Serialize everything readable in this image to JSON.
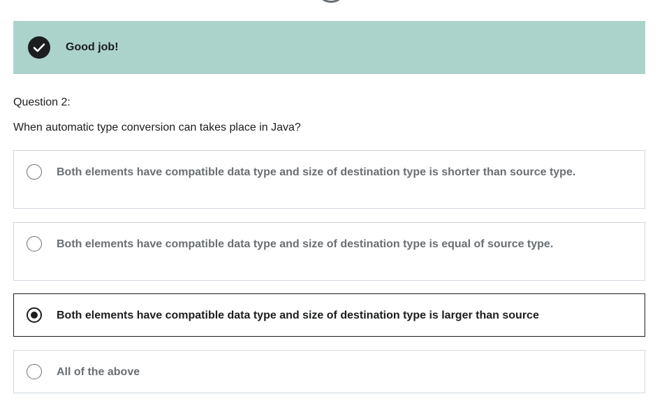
{
  "result": {
    "message": "Good job!",
    "icon": "check-circle-icon",
    "background_color": "#acd2cc"
  },
  "question": {
    "number_label": "Question 2:",
    "text": "When automatic type conversion can takes place in Java?"
  },
  "options": [
    {
      "label": "Both elements have compatible data type and size of destination type is shorter than source type.",
      "selected": false
    },
    {
      "label": "Both elements have compatible data type and size of destination type is equal of source type.",
      "selected": false
    },
    {
      "label": "Both elements have compatible data type and size of destination type is larger than source",
      "selected": true
    },
    {
      "label": "All of the above",
      "selected": false
    }
  ]
}
